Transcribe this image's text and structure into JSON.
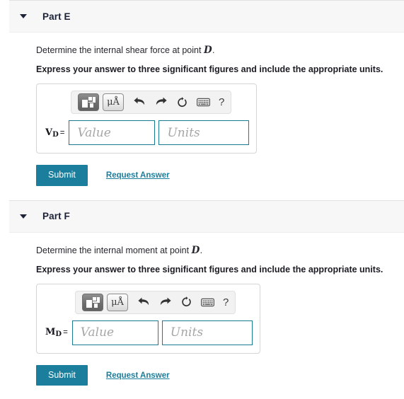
{
  "page": {
    "accent_color": "#1b7e9c",
    "header_bg": "#f7f7f7",
    "field_border_color": "#1b7a94"
  },
  "toolbar": {
    "template_button_label": "template-picker",
    "units_button_label": "μÅ",
    "undo_label": "undo",
    "redo_label": "redo",
    "reset_label": "reset",
    "keyboard_label": "keyboard",
    "help_label": "?"
  },
  "fields": {
    "value_placeholder": "Value",
    "units_placeholder": "Units"
  },
  "actions": {
    "submit_label": "Submit",
    "request_answer_label": "Request Answer"
  },
  "parts": [
    {
      "title": "Part E",
      "prompt_pre": "Determine the internal shear force at point ",
      "prompt_var": "D",
      "prompt_post": ".",
      "significant_figures_note": "Express your answer to three significant figures and include the appropriate units.",
      "answer_variable": "V",
      "answer_subscript": "D",
      "equals": "="
    },
    {
      "title": "Part F",
      "prompt_pre": "Determine the internal moment at point ",
      "prompt_var": "D",
      "prompt_post": ".",
      "significant_figures_note": "Express your answer to three significant figures and include the appropriate units.",
      "answer_variable": "M",
      "answer_subscript": "D",
      "equals": "="
    }
  ]
}
